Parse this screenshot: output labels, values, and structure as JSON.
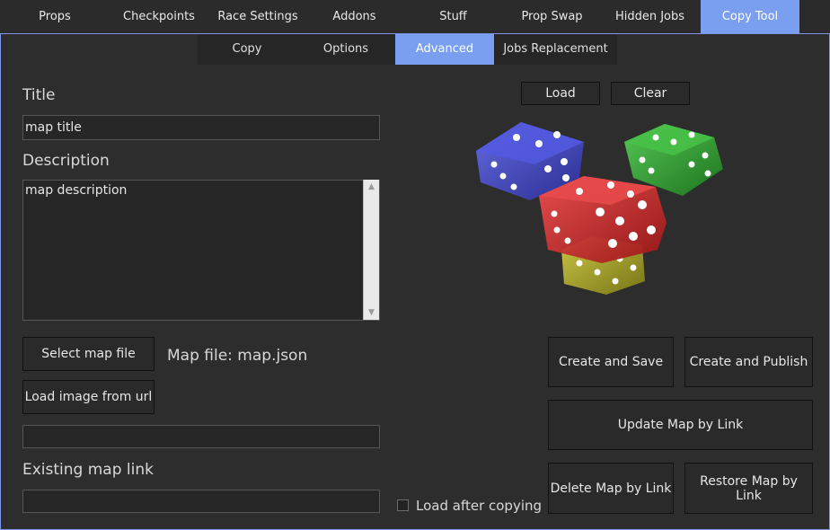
{
  "top_tabs": [
    {
      "label": "Props",
      "active": false
    },
    {
      "label": "Checkpoints",
      "active": false
    },
    {
      "label": "Race Settings",
      "active": false
    },
    {
      "label": "Addons",
      "active": false
    },
    {
      "label": "Stuff",
      "active": false
    },
    {
      "label": "Prop Swap",
      "active": false
    },
    {
      "label": "Hidden Jobs",
      "active": false
    },
    {
      "label": "Copy Tool",
      "active": true
    }
  ],
  "sub_tabs": [
    {
      "label": "Copy",
      "active": false
    },
    {
      "label": "Options",
      "active": false
    },
    {
      "label": "Advanced",
      "active": true
    },
    {
      "label": "Jobs Replacement",
      "active": false
    }
  ],
  "form": {
    "title_label": "Title",
    "title_value": "map title",
    "description_label": "Description",
    "description_value": "map description",
    "select_map_button": "Select map file",
    "map_file_text": "Map file: map.json",
    "load_image_button": "Load image from url",
    "image_url_value": "",
    "existing_link_label": "Existing map link",
    "existing_link_value": ""
  },
  "right": {
    "load_button": "Load",
    "clear_button": "Clear",
    "create_save_button": "Create and Save",
    "create_publish_button": "Create and Publish",
    "update_button": "Update Map by Link",
    "delete_button": "Delete Map by Link",
    "restore_button": "Restore Map by Link",
    "load_after_copying_label": "Load after copying",
    "load_after_copying_checked": false
  },
  "colors": {
    "accent": "#7a9ef0",
    "panel_border": "#7f96e6",
    "dice_blue": "#3f45c9",
    "dice_green": "#2fa82f",
    "dice_red": "#d12a2a",
    "dice_yellow": "#b9b52a"
  },
  "icons": {
    "image": "dice-image"
  }
}
